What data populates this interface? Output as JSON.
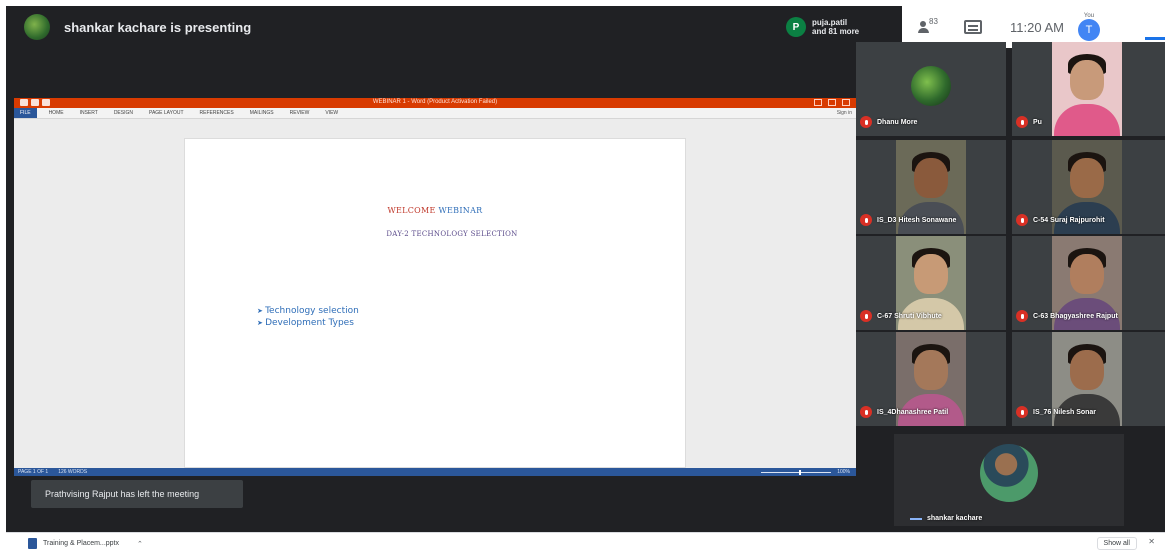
{
  "meeting": {
    "presenting_text": "shankar kachare is presenting",
    "participants_line1": "puja.patil",
    "participants_line2": "and 81 more",
    "participant_initial": "P"
  },
  "controls": {
    "people_count": "83",
    "time": "11:20 AM",
    "me_initial": "T",
    "me_label": "You"
  },
  "shared_window": {
    "doc_title": "WEBINAR 1 - Word (Product Activation Failed)",
    "ribbon_tabs": [
      "FILE",
      "HOME",
      "INSERT",
      "DESIGN",
      "PAGE LAYOUT",
      "REFERENCES",
      "MAILINGS",
      "REVIEW",
      "VIEW"
    ],
    "signin": "Sign in",
    "welcome_word1": "WELCOME",
    "welcome_word2": "WEBINAR",
    "subtitle": "DAY-2 TECHNOLOGY SELECTION",
    "bullets": [
      "Technology selection",
      "Development Types"
    ],
    "status_page": "PAGE 1 OF 1",
    "status_words": "126 WORDS",
    "zoom_percent": "100%"
  },
  "notification": "Prathvising Rajput has left the meeting",
  "tiles": [
    {
      "name": "Dhanu More"
    },
    {
      "name": "Pu"
    },
    {
      "name": "IS_D3 Hitesh Sonawane"
    },
    {
      "name": "C-54 Suraj Rajpurohit"
    },
    {
      "name": "C-67 Shruti Vibhute"
    },
    {
      "name": "C-63 Bhagyashree Rajput"
    },
    {
      "name": "IS_4Dhanashree Patil"
    },
    {
      "name": "IS_76 Nilesh Sonar"
    }
  ],
  "presenter_tile": {
    "name": "shankar kachare"
  },
  "download": {
    "file_name": "Training & Placem...pptx",
    "show_all": "Show all",
    "close": "✕"
  }
}
